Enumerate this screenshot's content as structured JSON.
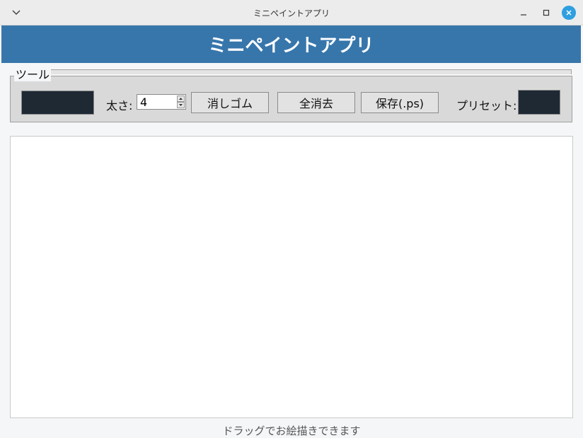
{
  "window": {
    "title": "ミニペイントアプリ"
  },
  "header": {
    "heading": "ミニペイントアプリ",
    "background": "#3776ab"
  },
  "toolbar": {
    "group_label": "ツール",
    "current_color": "#1e2934",
    "size_label": "太さ:",
    "size_value": "4",
    "eraser_label": "消しゴム",
    "clear_all_label": "全消去",
    "save_label": "保存(.ps)",
    "preset_label": "プリセット:",
    "preset_color": "#1e2934"
  },
  "status": {
    "message": "ドラッグでお絵描きできます"
  }
}
